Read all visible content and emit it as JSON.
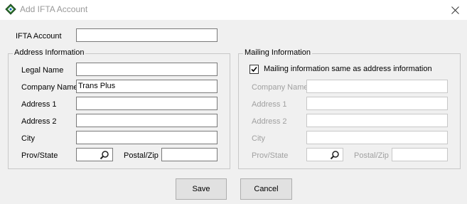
{
  "window": {
    "title": "Add IFTA Account"
  },
  "ifta_account": {
    "label": "IFTA Account",
    "value": ""
  },
  "address": {
    "group_title": "Address Information",
    "legal_name": {
      "label": "Legal Name",
      "value": ""
    },
    "company_name": {
      "label": "Company Name",
      "value": "Trans Plus"
    },
    "address1": {
      "label": "Address 1",
      "value": ""
    },
    "address2": {
      "label": "Address 2",
      "value": ""
    },
    "city": {
      "label": "City",
      "value": ""
    },
    "prov_state": {
      "label": "Prov/State",
      "value": ""
    },
    "postal_zip": {
      "label": "Postal/Zip",
      "value": ""
    }
  },
  "mailing": {
    "group_title": "Mailing Information",
    "same_checkbox": {
      "label": "Mailing information same as address information",
      "checked": true
    },
    "company_name": {
      "label": "Company Name",
      "value": ""
    },
    "address1": {
      "label": "Address 1",
      "value": ""
    },
    "address2": {
      "label": "Address 2",
      "value": ""
    },
    "city": {
      "label": "City",
      "value": ""
    },
    "prov_state": {
      "label": "Prov/State",
      "value": ""
    },
    "postal_zip": {
      "label": "Postal/Zip",
      "value": ""
    }
  },
  "buttons": {
    "save": "Save",
    "cancel": "Cancel"
  },
  "icons": {
    "app": "app-diamond-icon",
    "close": "close-icon",
    "search": "search-icon",
    "check": "check-icon"
  }
}
